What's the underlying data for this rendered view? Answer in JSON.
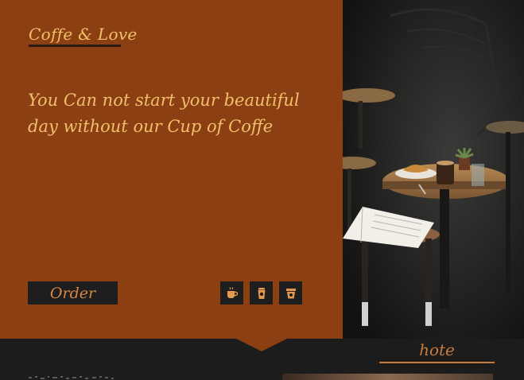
{
  "hero": {
    "brand": "Coffe & Love",
    "tagline": "You Can not start your beautiful day without our Cup of Coffe",
    "order_label": "Order",
    "actions": [
      {
        "icon": "coffee-cup-icon"
      },
      {
        "icon": "coffee-to-go-icon"
      },
      {
        "icon": "coffee-mug-icon"
      }
    ]
  },
  "section": {
    "title": "hote"
  },
  "colors": {
    "hero_bg": "#8b3f12",
    "accent_text": "#f0c06a",
    "button_bg": "#1e1e1e",
    "button_text": "#d8893f",
    "page_bg": "#1c1c1c",
    "section_title": "#c97a3a"
  }
}
